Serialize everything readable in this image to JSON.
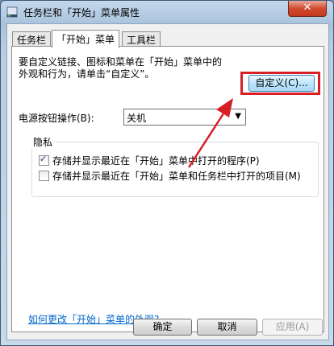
{
  "window": {
    "title": "任务栏和「开始」菜单属性",
    "close_glyph": "✕"
  },
  "tabs": [
    {
      "label": "任务栏",
      "active": false
    },
    {
      "label": "「开始」菜单",
      "active": true
    },
    {
      "label": "工具栏",
      "active": false
    }
  ],
  "start_menu": {
    "customize_description": "要自定义链接、图标和菜单在「开始」菜单中的\n外观和行为，请单击“自定义”。",
    "customize_button": "自定义(C)...",
    "power_label": "电源按钮操作(B):",
    "power_value": "关机",
    "privacy_group_title": "隐私",
    "privacy_options": [
      {
        "label": "存储并显示最近在「开始」菜单中打开的程序(P)",
        "checked": true
      },
      {
        "label": "存储并显示最近在「开始」菜单和任务栏中打开的项目(M)",
        "checked": false
      }
    ],
    "appearance_link": "如何更改「开始」菜单的外观?"
  },
  "footer": {
    "ok": "确定",
    "cancel": "取消",
    "apply": "应用(A)"
  },
  "annotation": {
    "color": "#d81f26"
  }
}
